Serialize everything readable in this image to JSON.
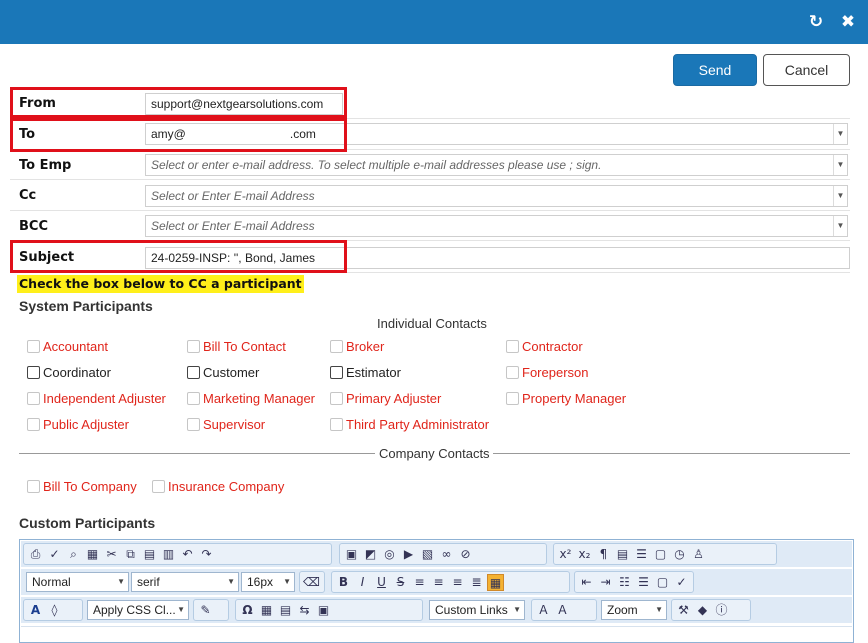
{
  "header": {
    "refresh_icon": "↻",
    "close_icon": "✖",
    "bg_color": "#1a77b8"
  },
  "actions": {
    "send_label": "Send",
    "cancel_label": "Cancel"
  },
  "form": {
    "from": {
      "label": "From",
      "value": "support@nextgearsolutions.com"
    },
    "to": {
      "label": "To",
      "value_left": "amy@",
      "value_right": ".com"
    },
    "to_emp": {
      "label": "To Emp",
      "placeholder": "Select or enter e-mail address. To select multiple e-mail addresses please use ; sign."
    },
    "cc": {
      "label": "Cc",
      "placeholder": "Select or Enter E-mail Address"
    },
    "bcc": {
      "label": "BCC",
      "placeholder": "Select or Enter E-mail Address"
    },
    "subject": {
      "label": "Subject",
      "value": "24-0259-INSP: '', Bond, James"
    }
  },
  "hint": "Check the box below to CC a participant",
  "system_participants": {
    "heading": "System Participants",
    "individual_heading": "Individual Contacts",
    "individuals": [
      {
        "label": "Accountant",
        "state": "disabled"
      },
      {
        "label": "Bill To Contact",
        "state": "disabled"
      },
      {
        "label": "Broker",
        "state": "disabled"
      },
      {
        "label": "Contractor",
        "state": "disabled"
      },
      {
        "label": "Coordinator",
        "state": "enabled"
      },
      {
        "label": "Customer",
        "state": "enabled"
      },
      {
        "label": "Estimator",
        "state": "enabled"
      },
      {
        "label": "Foreperson",
        "state": "disabled"
      },
      {
        "label": "Independent Adjuster",
        "state": "disabled"
      },
      {
        "label": "Marketing Manager",
        "state": "disabled"
      },
      {
        "label": "Primary Adjuster",
        "state": "disabled"
      },
      {
        "label": "Property Manager",
        "state": "disabled"
      },
      {
        "label": "Public Adjuster",
        "state": "disabled"
      },
      {
        "label": "Supervisor",
        "state": "disabled"
      },
      {
        "label": "Third Party Administrator",
        "state": "disabled"
      }
    ],
    "company_heading": "Company Contacts",
    "companies": [
      {
        "label": "Bill To Company",
        "state": "disabled"
      },
      {
        "label": "Insurance Company",
        "state": "disabled"
      }
    ]
  },
  "custom_participants": {
    "heading": "Custom Participants"
  },
  "editor": {
    "format_value": "Normal",
    "font_value": "serif",
    "size_value": "16px",
    "css_value": "Apply CSS Cl...",
    "links_value": "Custom Links",
    "zoom_value": "Zoom",
    "b_label": "B",
    "i_label": "I",
    "u_label": "U",
    "font_color_label": "A"
  }
}
